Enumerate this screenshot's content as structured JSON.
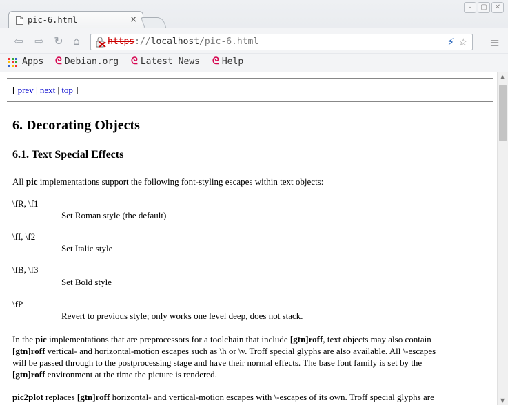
{
  "tab": {
    "title": "pic-6.html",
    "close": "×"
  },
  "window_buttons": [
    "–",
    "▢",
    "✕"
  ],
  "nav": {
    "back": "⇦",
    "forward": "⇨",
    "reload": "↻",
    "home": "⌂"
  },
  "omnibox": {
    "scheme": "https",
    "separator": "://",
    "host": "localhost",
    "path": "/pic-6.html",
    "bolt": "⚡",
    "star": "☆"
  },
  "menu_icon": "≡",
  "bookmarks": [
    {
      "label": "Apps",
      "icon": "apps-grid-icon"
    },
    {
      "label": "Debian.org",
      "icon": "debian-swirl-icon"
    },
    {
      "label": "Latest News",
      "icon": "debian-swirl-icon"
    },
    {
      "label": "Help",
      "icon": "debian-swirl-icon"
    }
  ],
  "debian_glyph": "ᘓ",
  "doc": {
    "nav": {
      "open": "[ ",
      "prev": "prev",
      "sep1": " | ",
      "next": "next",
      "sep2": " | ",
      "top": "top",
      "close": " ]"
    },
    "h1": "6. Decorating Objects",
    "h2": "6.1. Text Special Effects",
    "intro": {
      "pre": "All ",
      "bold": "pic",
      "post": " implementations support the following font-styling escapes within text objects:"
    },
    "defs": [
      {
        "term": "\\fR, \\f1",
        "desc": "Set Roman style (the default)"
      },
      {
        "term": "\\fI, \\f2",
        "desc": "Set Italic style"
      },
      {
        "term": "\\fB, \\f3",
        "desc": "Set Bold style"
      },
      {
        "term": "\\fP",
        "desc": "Revert to previous style; only works one level deep, does not stack."
      }
    ],
    "para2": {
      "s1": "In the ",
      "b1": "pic",
      "s2": " implementations that are preprocessors for a toolchain that include ",
      "b2": "[gtn]roff",
      "s3": ", text objects may also contain",
      "b3": "[gtn]roff",
      "s4": " vertical- and horizontal-motion escapes such as \\h or \\v. Troff special glyphs are also available. All \\-escapes",
      "s5": "will be passed through to the postprocessing stage and have their normal effects. The base font family is set by the",
      "b4": "[gtn]roff",
      "s6": " environment at the time the picture is rendered."
    },
    "para3": {
      "b1": "pic2plot",
      "s1": " replaces ",
      "b2": "[gtn]roff",
      "s2": " horizontal- and vertical-motion escapes with \\-escapes of its own. Troff special glyphs are"
    }
  },
  "colors": {
    "link": "#0000cc",
    "debian": "#d70751",
    "https_strike": "#cc0000",
    "bolt": "#1f5fb8"
  }
}
